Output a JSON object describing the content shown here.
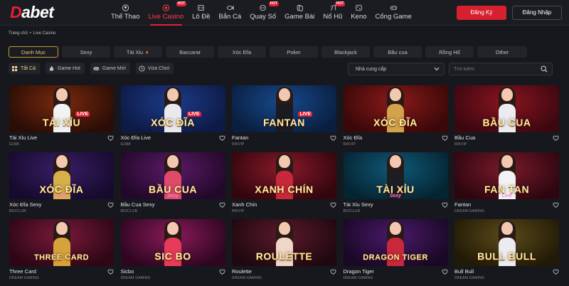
{
  "brand": {
    "logo_d": "D",
    "logo_rest": "abet"
  },
  "nav": [
    {
      "label": "Thể Thao",
      "icon": "soccer-ball-icon",
      "active": false,
      "badge": ""
    },
    {
      "label": "Live Casino",
      "icon": "casino-chip-icon",
      "active": true,
      "badge": "HOT"
    },
    {
      "label": "Lô Đề",
      "icon": "lottery-icon",
      "active": false,
      "badge": ""
    },
    {
      "label": "Bắn Cá",
      "icon": "fish-icon",
      "active": false,
      "badge": ""
    },
    {
      "label": "Quay Số",
      "icon": "lottery-ball-icon",
      "active": false,
      "badge": "HOT"
    },
    {
      "label": "Game Bài",
      "icon": "cards-icon",
      "active": false,
      "badge": ""
    },
    {
      "label": "Nổ Hũ",
      "icon": "slot-icon",
      "active": false,
      "badge": "HOT"
    },
    {
      "label": "Keno",
      "icon": "keno-icon",
      "active": false,
      "badge": ""
    },
    {
      "label": "Cổng Game",
      "icon": "gamepad-icon",
      "active": false,
      "badge": ""
    }
  ],
  "auth": {
    "register": "Đăng Ký",
    "login": "Đăng Nhập"
  },
  "breadcrumb": {
    "home": "Trang chủ",
    "sep": "•",
    "current": "Live Casino"
  },
  "categories": [
    {
      "label": "Danh Mục",
      "active": true,
      "hot": false
    },
    {
      "label": "Sexy",
      "active": false,
      "hot": false
    },
    {
      "label": "Tài Xỉu",
      "active": false,
      "hot": true
    },
    {
      "label": "Baccarat",
      "active": false,
      "hot": false
    },
    {
      "label": "Xóc Đĩa",
      "active": false,
      "hot": false
    },
    {
      "label": "Poker",
      "active": false,
      "hot": false
    },
    {
      "label": "Blackjack",
      "active": false,
      "hot": false
    },
    {
      "label": "Bầu cua",
      "active": false,
      "hot": false
    },
    {
      "label": "Rồng Hổ",
      "active": false,
      "hot": false
    },
    {
      "label": "Other",
      "active": false,
      "hot": false
    }
  ],
  "filters": [
    {
      "label": "Tất Cả",
      "icon": "grid-icon",
      "active": true
    },
    {
      "label": "Game Hot",
      "icon": "flame-icon",
      "active": false
    },
    {
      "label": "Game Mới",
      "icon": "new-icon",
      "active": false
    },
    {
      "label": "Vừa Chơi",
      "icon": "clock-icon",
      "active": false
    }
  ],
  "provider_select": {
    "value": "Nhà cung cấp"
  },
  "search": {
    "placeholder": "Tìm kiếm"
  },
  "games": [
    {
      "name": "Tài Xỉu Live",
      "provider": "GO88",
      "art": "TÀI XỈU",
      "tag": "LIVE",
      "sub": "",
      "bg1": "#7a2a0e",
      "bg2": "#2a0d06",
      "outfit": "#f2f2f2"
    },
    {
      "name": "Xóc Đĩa Live",
      "provider": "GO88",
      "art": "XÓC ĐĨA",
      "tag": "LIVE",
      "sub": "",
      "bg1": "#1d3b8a",
      "bg2": "#0d1a45",
      "outfit": "#e9e9ee"
    },
    {
      "name": "Fantan",
      "provider": "RIKVIP",
      "art": "FANTAN",
      "tag": "LIVE",
      "sub": "",
      "bg1": "#174a8e",
      "bg2": "#0a1f40",
      "outfit": "#1a1a22"
    },
    {
      "name": "Xóc Đĩa",
      "provider": "RIKVIP",
      "art": "XÓC ĐĨA",
      "tag": "",
      "sub": "",
      "bg1": "#8a1a1a",
      "bg2": "#3a0808",
      "outfit": "#d4a24a"
    },
    {
      "name": "Bầu Cua",
      "provider": "RIKVIP",
      "art": "BẦU CUA",
      "tag": "",
      "sub": "",
      "bg1": "#8a1420",
      "bg2": "#3c0810",
      "outfit": "#ececf0"
    },
    {
      "name": "Xóc Đĩa Sexy",
      "provider": "B52CLUB",
      "art": "XÓC ĐĨA",
      "tag": "",
      "sub": "Sexy",
      "bg1": "#3a1e66",
      "bg2": "#160a2e",
      "outfit": "#d8b04a"
    },
    {
      "name": "Bầu Cua Sexy",
      "provider": "B52CLUB",
      "art": "BẦU CUA",
      "tag": "",
      "sub": "Sexy",
      "bg1": "#5a1a66",
      "bg2": "#22082a",
      "outfit": "#e04a6a"
    },
    {
      "name": "Xanh Chín",
      "provider": "RIKVIP",
      "art": "XANH CHÍN",
      "tag": "",
      "sub": "",
      "bg1": "#8a1a2a",
      "bg2": "#33060e",
      "outfit": "#c8283a"
    },
    {
      "name": "Tài Xỉu Sexy",
      "provider": "B52CLUB",
      "art": "TÀI XỈU",
      "tag": "",
      "sub": "Sexy",
      "bg1": "#0f5a78",
      "bg2": "#052432",
      "outfit": "#1d1d24"
    },
    {
      "name": "Fantan",
      "provider": "DREAM GAMING",
      "art": "FAN TAN",
      "tag": "",
      "sub": "Live",
      "bg1": "#7a1a2a",
      "bg2": "#2e0610",
      "outfit": "#f2f2f4"
    },
    {
      "name": "Three Card",
      "provider": "DREAM GAMING",
      "art": "THREE CARD",
      "tag": "",
      "sub": "",
      "bg1": "#7a1a3a",
      "bg2": "#2e0616",
      "outfit": "#d6a23a"
    },
    {
      "name": "Sicbo",
      "provider": "DREAM GAMING",
      "art": "SIC BO",
      "tag": "",
      "sub": "",
      "bg1": "#8a1a5a",
      "bg2": "#2e0620",
      "outfit": "#e83a5a"
    },
    {
      "name": "Roulette",
      "provider": "DREAM GAMING",
      "art": "ROULETTE",
      "tag": "",
      "sub": "",
      "bg1": "#5a1a2a",
      "bg2": "#200810",
      "outfit": "#f0d6c8"
    },
    {
      "name": "Dragon Tiger",
      "provider": "DREAM GAMING",
      "art": "DRAGON TIGER",
      "tag": "",
      "sub": "",
      "bg1": "#4a1a6a",
      "bg2": "#1a0826",
      "outfit": "#c8283a"
    },
    {
      "name": "Bull Bull",
      "provider": "DREAM GAMING",
      "art": "BULL BULL",
      "tag": "",
      "sub": "",
      "bg1": "#5a4a1a",
      "bg2": "#221a06",
      "outfit": "#ececf0"
    }
  ]
}
